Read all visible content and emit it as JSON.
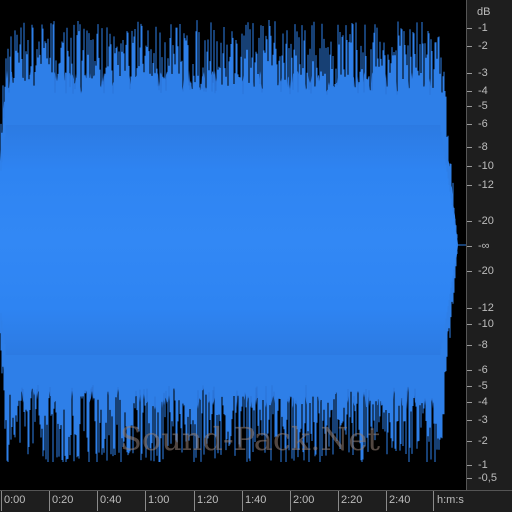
{
  "watermark": "Sound-Pack.Net",
  "db_scale": {
    "unit": "dB",
    "labels": [
      "-1",
      "-2",
      "-3",
      "-4",
      "-5",
      "-6",
      "-8",
      "-10",
      "-12",
      "-20",
      "-∞",
      "-20",
      "-12",
      "-10",
      "-8",
      "-6",
      "-5",
      "-4",
      "-3",
      "-2",
      "-1",
      "-0,5"
    ]
  },
  "time_ruler": {
    "labels": [
      "0:00",
      "0:20",
      "0:40",
      "1:00",
      "1:20",
      "1:40",
      "2:00",
      "2:20",
      "2:40"
    ],
    "unit": "h:m:s"
  },
  "colors": {
    "waveform": "#2e7fe8",
    "waveform_dark": "#2a62b8",
    "background": "#000000",
    "panel": "#1e1e1e"
  }
}
